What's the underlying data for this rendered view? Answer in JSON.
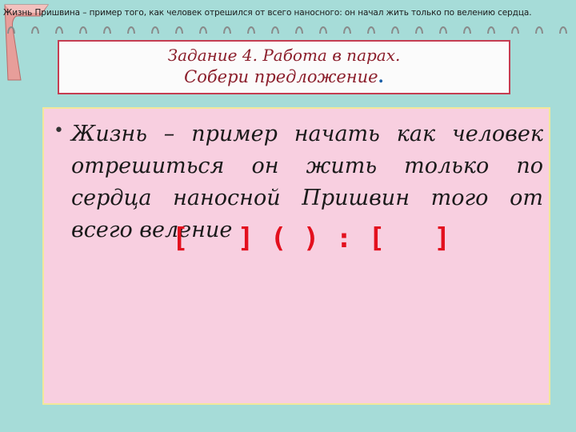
{
  "header": {
    "caption": "Жизнь Пришвина – пример того, как человек отрешился от всего наносного: он начал жить только по велению сердца."
  },
  "title": {
    "line1": "Задание 4. Работа в парах.",
    "line2": "Собери предложение",
    "line2_dot": "."
  },
  "content": {
    "bullet": "•",
    "words": "Жизнь – пример начать как человек отрешиться он жить только по сердца наносной Пришвин того от всего веление",
    "scheme": "[   ] ( ) : [   ]"
  },
  "colors": {
    "background": "#a6dcd8",
    "title_text": "#8b1e2b",
    "title_border": "#c53d51",
    "content_bg": "#f8cfe0",
    "content_border": "#f2e79a",
    "scheme": "#e3101e"
  },
  "icons": [
    "boomerang-icon",
    "binder-rings-icon"
  ]
}
